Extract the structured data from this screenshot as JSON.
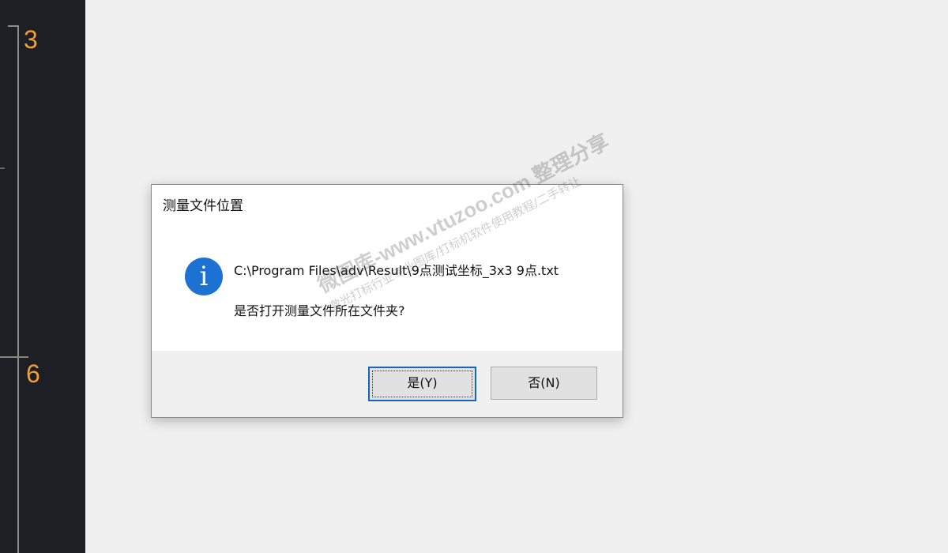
{
  "canvas": {
    "label_top": "3",
    "label_mid": "6",
    "label_color": "#f0a030"
  },
  "dialog": {
    "title": "测量文件位置",
    "icon": "info-icon",
    "icon_glyph": "i",
    "message_path": "C:\\Program Files\\adv\\Result\\9点测试坐标_3x3 9点.txt",
    "message_question": "是否打开测量文件所在文件夹?",
    "yes_label": "是(Y)",
    "no_label": "否(N)",
    "accent_color": "#1c71d2"
  },
  "watermark": {
    "line1": "微图库-www.vtuzoo.com 整理分享",
    "line2": "激光打标行业专业图库/打标机软件使用教程/二手转让"
  }
}
